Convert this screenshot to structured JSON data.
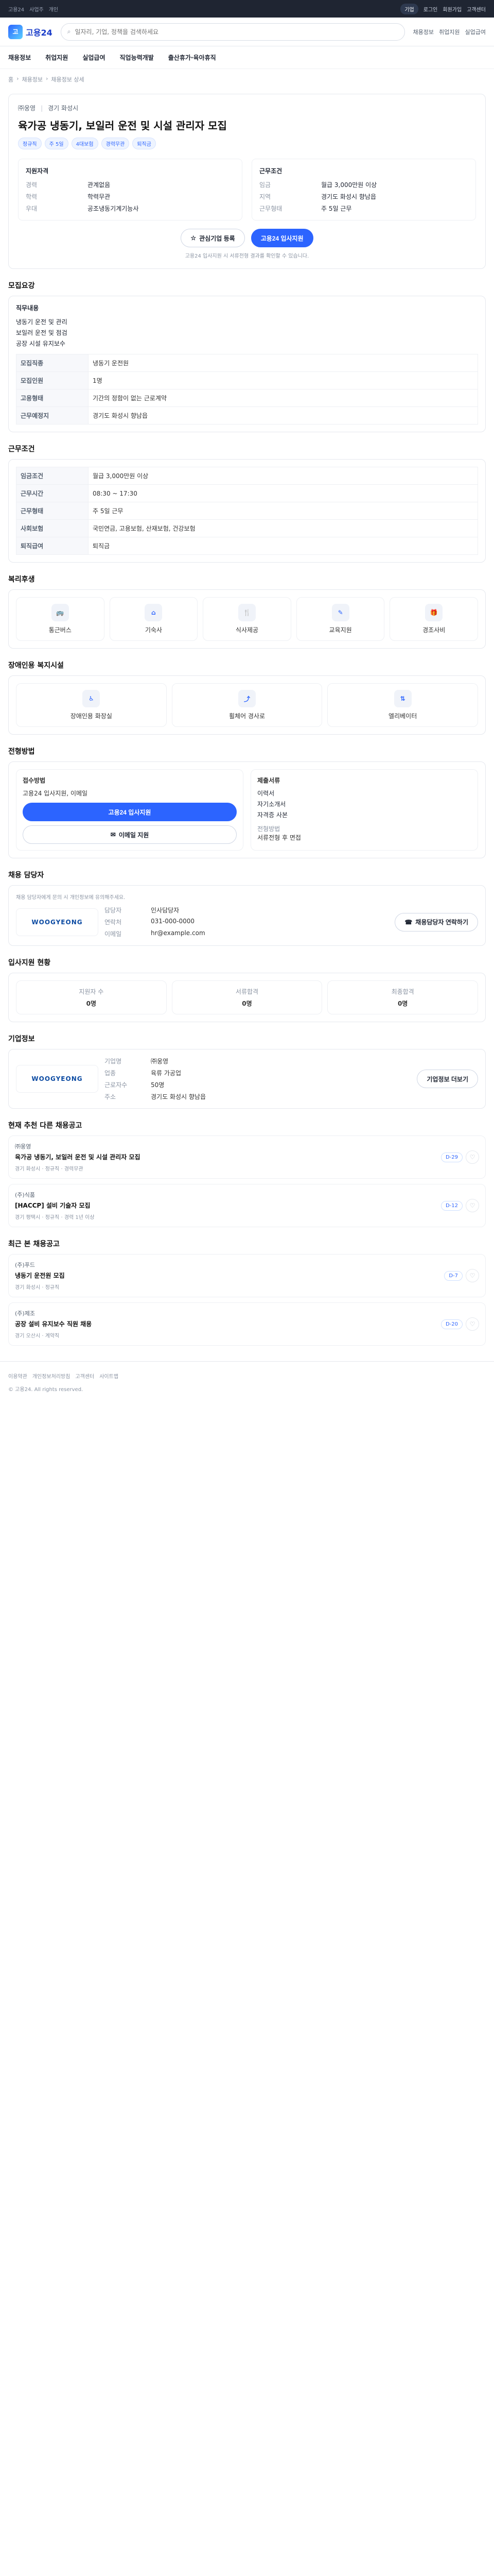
{
  "util": {
    "left_links": [
      "고용24",
      "사업주",
      "개인"
    ],
    "right_links": [
      "로그인",
      "회원가입",
      "고객센터"
    ],
    "pill": "기업"
  },
  "header": {
    "logo_mark": "고",
    "logo_text": "고용24",
    "search_placeholder": "일자리, 기업, 정책을 검색하세요",
    "actions": [
      "채용정보",
      "취업지원",
      "실업급여",
      "직업능력개발",
      "출산휴가·육아휴직"
    ]
  },
  "nav": {
    "items": [
      "채용정보",
      "취업지원",
      "실업급여",
      "직업능력개발",
      "출산휴가·육아휴직"
    ]
  },
  "breadcrumb": [
    "홈",
    "채용정보",
    "채용정보 상세"
  ],
  "job": {
    "company": "㈜웅영",
    "location": "경기 화성시",
    "title": "육가공 냉동기, 보일러 운전 및 시설 관리자 모집",
    "tags": [
      "정규직",
      "주 5일",
      "4대보험",
      "경력무관",
      "퇴직금"
    ],
    "summary": {
      "left": {
        "title": "지원자격",
        "rows": [
          {
            "k": "경력",
            "v": "관계없음"
          },
          {
            "k": "학력",
            "v": "학력무관"
          },
          {
            "k": "우대",
            "v": "공조냉동기계기능사"
          }
        ]
      },
      "right": {
        "title": "근무조건",
        "rows": [
          {
            "k": "임금",
            "v": "월급 3,000만원 이상"
          },
          {
            "k": "지역",
            "v": "경기도 화성시 향남읍"
          },
          {
            "k": "근무형태",
            "v": "주 5일 근무"
          }
        ]
      }
    },
    "cta": {
      "secondary": "관심기업 등록",
      "primary": "고용24 입사지원",
      "notice": "고용24 입사지원 시 서류전형 결과를 확인할 수 있습니다."
    }
  },
  "sections": {
    "recruit": {
      "title": "모집요강",
      "duties_title": "직무내용",
      "duties": [
        "냉동기 운전 및 관리",
        "보일러 운전 및 점검",
        "공장 시설 유지보수"
      ],
      "table": [
        {
          "k": "모집직종",
          "v": "냉동기 운전원"
        },
        {
          "k": "모집인원",
          "v": "1명"
        },
        {
          "k": "고용형태",
          "v": "기간의 정함이 없는 근로계약"
        },
        {
          "k": "근무예정지",
          "v": "경기도 화성시 향남읍"
        }
      ]
    },
    "conditions": {
      "title": "근무조건",
      "table": [
        {
          "k": "임금조건",
          "v": "월급 3,000만원 이상"
        },
        {
          "k": "근무시간",
          "v": "08:30 ~ 17:30"
        },
        {
          "k": "근무형태",
          "v": "주 5일 근무"
        },
        {
          "k": "사회보험",
          "v": "국민연금, 고용보험, 산재보험, 건강보험"
        },
        {
          "k": "퇴직급여",
          "v": "퇴직금"
        }
      ]
    },
    "benefits": {
      "title": "복리후생",
      "items": [
        "통근버스",
        "기숙사",
        "식사제공",
        "교육지원",
        "경조사비"
      ]
    },
    "disability": {
      "title": "장애인용 복지시설",
      "items": [
        "장애인용 화장실",
        "휠체어 경사로",
        "엘리베이터"
      ]
    },
    "apply": {
      "title": "전형방법",
      "method": "서류전형 후 면접",
      "doc_title": "제출서류",
      "docs": [
        "이력서",
        "자기소개서",
        "자격증 사본"
      ],
      "btn_apply": "고용24 입사지원",
      "btn_email": "이메일 지원",
      "info_title": "접수방법",
      "info": "고용24 입사지원, 이메일"
    },
    "contact": {
      "title": "채용 담당자",
      "notice": "채용 담당자에게 문의 시 개인정보에 유의해주세요.",
      "logo_text": "WOOGYEONG",
      "rows": [
        {
          "k": "담당자",
          "v": "인사담당자"
        },
        {
          "k": "연락처",
          "v": "031-000-0000"
        },
        {
          "k": "이메일",
          "v": "hr@example.com"
        }
      ],
      "btn": "채용담당자 연락하기"
    },
    "stats": {
      "title": "입사지원 현황",
      "items": [
        {
          "label": "지원자 수",
          "value": "0명"
        },
        {
          "label": "서류합격",
          "value": "0명"
        },
        {
          "label": "최종합격",
          "value": "0명"
        }
      ]
    },
    "company": {
      "title": "기업정보",
      "rows": [
        {
          "k": "기업명",
          "v": "㈜웅영"
        },
        {
          "k": "업종",
          "v": "육류 가공업"
        },
        {
          "k": "근로자수",
          "v": "50명"
        },
        {
          "k": "주소",
          "v": "경기도 화성시 향남읍"
        }
      ],
      "btn": "기업정보 더보기"
    },
    "similar": {
      "title": "현재 추천 다른 채용공고",
      "items": [
        {
          "company": "㈜웅영",
          "title": "육가공 냉동기, 보일러 운전 및 시설 관리자 모집",
          "meta": "경기 화성시 · 정규직 · 경력무관",
          "dday": "D-29"
        },
        {
          "company": "(주)식품",
          "title": "[HACCP] 설비 기술자 모집",
          "meta": "경기 평택시 · 정규직 · 경력 1년 이상",
          "dday": "D-12"
        }
      ]
    },
    "recent": {
      "title": "최근 본 채용공고",
      "items": [
        {
          "company": "(주)푸드",
          "title": "냉동기 운전원 모집",
          "meta": "경기 화성시 · 정규직",
          "dday": "D-7"
        },
        {
          "company": "(주)제조",
          "title": "공장 설비 유지보수 직원 채용",
          "meta": "경기 오산시 · 계약직",
          "dday": "D-20"
        }
      ]
    }
  },
  "footer": {
    "links": [
      "이용약관",
      "개인정보처리방침",
      "고객센터",
      "사이트맵"
    ],
    "copyright": "© 고용24. All rights reserved."
  }
}
